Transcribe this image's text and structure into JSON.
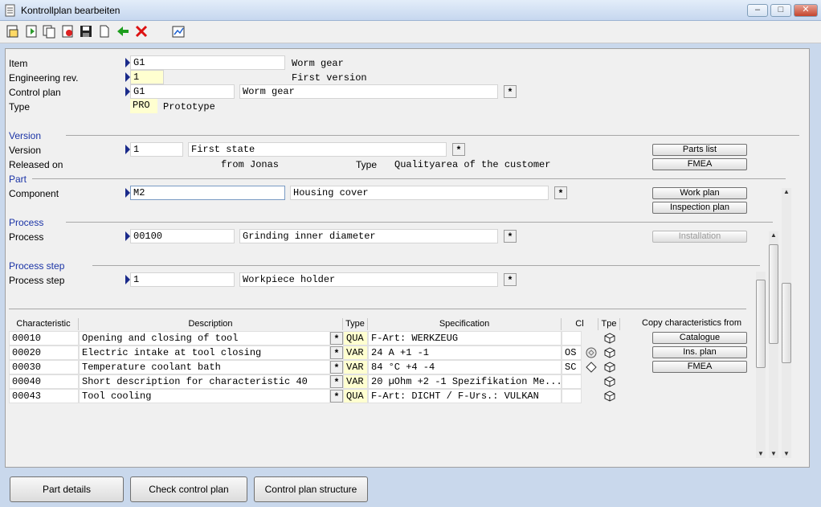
{
  "window": {
    "title": "Kontrollplan bearbeiten"
  },
  "header": {
    "item_label": "Item",
    "item_value": "G1",
    "item_desc": "Worm gear",
    "engrev_label": "Engineering rev.",
    "engrev_value": "1",
    "engrev_desc": "First version",
    "cplan_label": "Control plan",
    "cplan_value": "G1",
    "cplan_desc": "Worm gear",
    "type_label": "Type",
    "type_value": "PRO",
    "type_desc": "Prototype"
  },
  "version": {
    "section": "Version",
    "label": "Version",
    "value": "1",
    "desc": "First state",
    "released_label": "Released on",
    "from_text": "from Jonas",
    "type_label": "Type",
    "type_value": "Qualityarea of the customer",
    "btn_parts_list": "Parts list",
    "btn_fmea": "FMEA"
  },
  "part": {
    "section": "Part",
    "label": "Component",
    "value": "M2",
    "desc": "Housing cover",
    "btn_work_plan": "Work plan",
    "btn_inspection_plan": "Inspection plan"
  },
  "process": {
    "section": "Process",
    "label": "Process",
    "value": "00100",
    "desc": "Grinding inner diameter",
    "btn_installation": "Installation"
  },
  "process_step": {
    "section": "Process step",
    "label": "Process step",
    "value": "1",
    "desc": "Workpiece holder"
  },
  "table": {
    "headers": {
      "characteristic": "Characteristic",
      "description": "Description",
      "type": "Type",
      "specification": "Specification",
      "cl": "Cl",
      "tpe": "Tpe"
    },
    "rows": [
      {
        "char": "00010",
        "desc": "Opening and closing of tool",
        "type": "QUA",
        "spec": "F-Art: WERKZEUG",
        "cl": ""
      },
      {
        "char": "00020",
        "desc": "Electric intake at tool closing",
        "type": "VAR",
        "spec": "24 A +1 -1",
        "cl": "OS"
      },
      {
        "char": "00030",
        "desc": "Temperature coolant bath",
        "type": "VAR",
        "spec": "84 °C +4 -4",
        "cl": "SC"
      },
      {
        "char": "00040",
        "desc": "Short description for characteristic 40",
        "type": "VAR",
        "spec": "20 µOhm +2 -1 Spezifikation Me...",
        "cl": ""
      },
      {
        "char": "00043",
        "desc": "Tool cooling",
        "type": "QUA",
        "spec": "F-Art: DICHT / F-Urs.: VULKAN",
        "cl": ""
      }
    ]
  },
  "copy": {
    "label": "Copy characteristics from",
    "btn_catalogue": "Catalogue",
    "btn_ins_plan": "Ins. plan",
    "btn_fmea": "FMEA"
  },
  "bottom": {
    "btn_part_details": "Part details",
    "btn_check": "Check control plan",
    "btn_structure": "Control plan structure"
  },
  "star": "*",
  "icons": [
    "document-icon",
    "new-icon",
    "copy-icon",
    "delete-icon",
    "save-icon",
    "blank-icon",
    "back-arrow-icon",
    "cancel-icon",
    "chart-icon"
  ]
}
